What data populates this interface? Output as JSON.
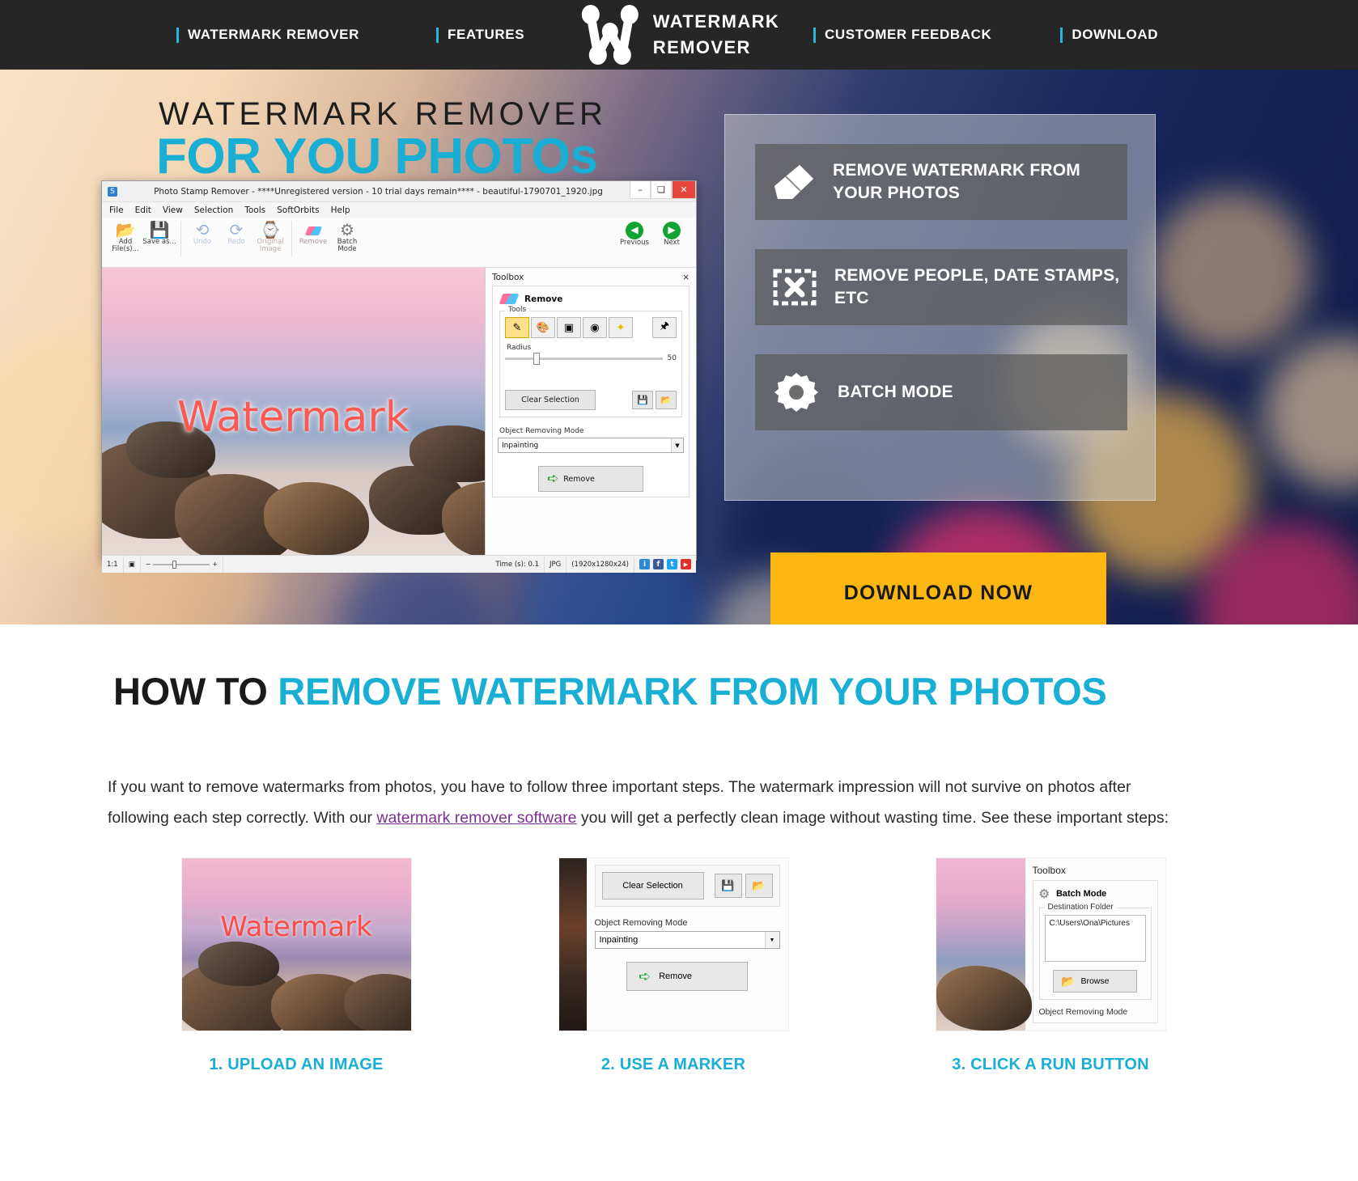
{
  "nav": {
    "left_items": [
      {
        "label": "WATERMARK REMOVER"
      },
      {
        "label": "FEATURES"
      }
    ],
    "right_items": [
      {
        "label": "CUSTOMER FEEDBACK"
      },
      {
        "label": "DOWNLOAD"
      }
    ],
    "logo": {
      "line1": "WATERMARK",
      "line2": "REMOVER",
      "icon": "w-logo-icon"
    },
    "accent_color": "#29b6d8",
    "background_color": "#262626"
  },
  "hero": {
    "title_line1": "WATERMARK  REMOVER",
    "title_line2": "FOR YOU PHOTOs",
    "title_accent_color": "#19aed4",
    "features": [
      {
        "icon": "eraser-icon",
        "label": "REMOVE WATERMARK FROM YOUR PHOTOS"
      },
      {
        "icon": "frame-x-icon",
        "label": "REMOVE PEOPLE, DATE STAMPS, ETC"
      },
      {
        "icon": "gear-icon",
        "label": "BATCH MODE"
      }
    ],
    "download_button": "DOWNLOAD NOW",
    "download_button_color": "#fcb713"
  },
  "app_window": {
    "title": "Photo Stamp Remover - ****Unregistered version - 10 trial days remain**** - beautiful-1790701_1920.jpg",
    "window_buttons": {
      "minimize": "–",
      "maximize": "❑",
      "close": "✕"
    },
    "menu": [
      "File",
      "Edit",
      "View",
      "Selection",
      "Tools",
      "SoftOrbits",
      "Help"
    ],
    "toolbar": [
      {
        "label": "Add File(s)...",
        "icon": "open-folder-icon"
      },
      {
        "label": "Save as...",
        "icon": "save-disk-icon"
      },
      {
        "label": "Undo",
        "icon": "undo-arrow-icon"
      },
      {
        "label": "Redo",
        "icon": "redo-arrow-icon"
      },
      {
        "label": "Original Image",
        "icon": "history-clock-icon"
      },
      {
        "label": "Remove",
        "icon": "eraser-icon"
      },
      {
        "label": "Batch Mode",
        "icon": "gear-icon"
      }
    ],
    "nav_buttons": [
      {
        "label": "Previous",
        "icon": "chevron-left-circle-icon"
      },
      {
        "label": "Next",
        "icon": "chevron-right-circle-icon"
      }
    ],
    "canvas_watermark_text": "Watermark",
    "toolbox": {
      "header": "Toolbox",
      "close": "×",
      "section_title": "Remove",
      "tools_legend": "Tools",
      "tools": [
        {
          "icon": "pencil-icon",
          "active": true
        },
        {
          "icon": "brush-icon",
          "active": false
        },
        {
          "icon": "rect-select-icon",
          "active": false
        },
        {
          "icon": "lasso-select-icon",
          "active": false
        },
        {
          "icon": "magic-wand-icon",
          "active": false
        },
        {
          "icon": "stamp-icon",
          "active": false
        }
      ],
      "radius_label": "Radius",
      "radius_value": "50",
      "clear_selection_label": "Clear Selection",
      "side_buttons": [
        {
          "icon": "save-selection-icon"
        },
        {
          "icon": "load-selection-icon"
        }
      ],
      "object_removing_mode_label": "Object Removing Mode",
      "object_removing_mode_value": "Inpainting",
      "remove_button_label": "Remove"
    },
    "statusbar": {
      "zoom": "1:1",
      "fit_icon": "fit-screen-icon",
      "time": "Time (s): 0.1",
      "format": "JPG",
      "dimensions": "(1920x1280x24)",
      "social": [
        {
          "name": "info-icon",
          "glyph": "i",
          "color": "#2b8ad6"
        },
        {
          "name": "facebook-icon",
          "glyph": "f",
          "color": "#3b5998"
        },
        {
          "name": "twitter-icon",
          "glyph": "t",
          "color": "#1da1f2"
        },
        {
          "name": "youtube-icon",
          "glyph": "▶",
          "color": "#e02f2f"
        }
      ]
    }
  },
  "howto": {
    "title_plain": "HOW TO ",
    "title_accent": "REMOVE WATERMARK FROM YOUR PHOTOS",
    "paragraph_part1": "If you want to remove watermarks from photos, you have to follow three important steps. The watermark impression will not survive on photos after following each step correctly. With our ",
    "paragraph_link": "watermark remover software",
    "paragraph_part2": " you will get a perfectly clean image without wasting time. See these important steps:",
    "steps": [
      {
        "caption": "1. UPLOAD AN IMAGE",
        "watermark_text": "Watermark"
      },
      {
        "caption": "2. USE A MARKER",
        "clear_selection_label": "Clear Selection",
        "object_removing_mode_label": "Object Removing Mode",
        "object_removing_mode_value": "Inpainting",
        "remove_button_label": "Remove"
      },
      {
        "caption": "3. CLICK A RUN BUTTON",
        "toolbox_header": "Toolbox",
        "batch_mode_label": "Batch Mode",
        "destination_folder_label": "Destination Folder",
        "destination_folder_value": "C:\\Users\\Ona\\Pictures",
        "browse_label": "Browse",
        "object_removing_mode_label": "Object Removing Mode"
      }
    ],
    "accent_color": "#19aed4",
    "link_color": "#7b2f8f"
  }
}
